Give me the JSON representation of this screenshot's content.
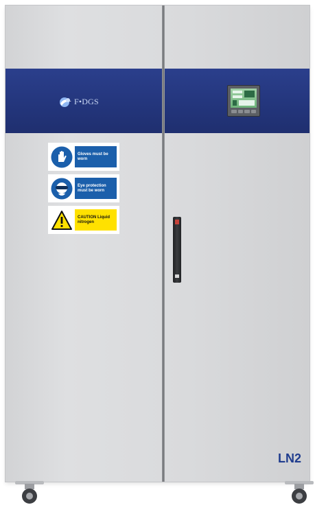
{
  "brand": {
    "logo_text": "F•DGS"
  },
  "signs": [
    {
      "text": "Gloves must be worn",
      "color": "#1b5fab",
      "icon": "gloves-icon"
    },
    {
      "text": "Eye protection must be worn",
      "color": "#1b5fab",
      "icon": "goggles-icon"
    },
    {
      "text": "CAUTION Liquid nitrogen",
      "color": "#ffe100",
      "icon": "warning-triangle-icon"
    }
  ],
  "cabinet": {
    "label": "LN2",
    "body_color": "#d9dadc",
    "band_color": "#23357b"
  }
}
